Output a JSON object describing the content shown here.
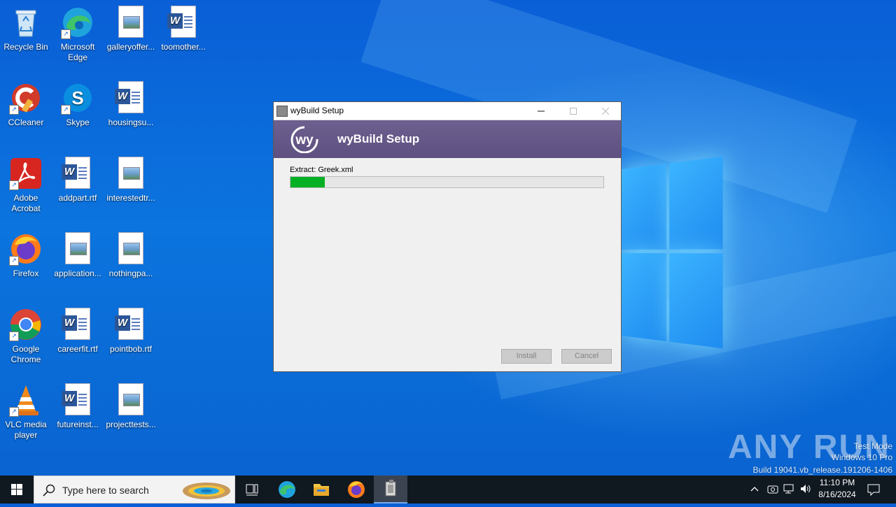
{
  "desktop": {
    "icons": [
      {
        "label": "Recycle Bin",
        "icon": "recycle-bin-icon"
      },
      {
        "label": "Microsoft Edge",
        "icon": "edge-icon"
      },
      {
        "label": "galleryoffer...",
        "icon": "image-file-icon"
      },
      {
        "label": "toomother...",
        "icon": "word-file-icon"
      },
      {
        "label": "CCleaner",
        "icon": "ccleaner-icon"
      },
      {
        "label": "Skype",
        "icon": "skype-icon"
      },
      {
        "label": "housingsu...",
        "icon": "word-file-icon"
      },
      {
        "label": "Adobe Acrobat",
        "icon": "acrobat-icon"
      },
      {
        "label": "addpart.rtf",
        "icon": "word-file-icon"
      },
      {
        "label": "interestedtr...",
        "icon": "image-file-icon"
      },
      {
        "label": "Firefox",
        "icon": "firefox-icon"
      },
      {
        "label": "application...",
        "icon": "image-file-icon"
      },
      {
        "label": "nothingpa...",
        "icon": "image-file-icon"
      },
      {
        "label": "Google Chrome",
        "icon": "chrome-icon"
      },
      {
        "label": "careerfit.rtf",
        "icon": "word-file-icon"
      },
      {
        "label": "pointbob.rtf",
        "icon": "word-file-icon"
      },
      {
        "label": "VLC media player",
        "icon": "vlc-icon"
      },
      {
        "label": "futureinst...",
        "icon": "word-file-icon"
      },
      {
        "label": "projecttests...",
        "icon": "image-file-icon"
      }
    ]
  },
  "dialog": {
    "window_title": "wyBuild Setup",
    "header_title": "wyBuild Setup",
    "status_text": "Extract: Greek.xml",
    "progress_fraction": 0.11,
    "install_label": "Install",
    "cancel_label": "Cancel",
    "header_color": "#6d5f8e",
    "progress_color": "#06b025"
  },
  "taskbar": {
    "search_placeholder": "Type here to search",
    "time": "11:10 PM",
    "date": "8/16/2024"
  },
  "watermark": {
    "line1": "Test Mode",
    "line2": "Windows 10 Pro",
    "line3": "Build 19041.vb_release.191206-1406",
    "brand": "ANY RUN"
  }
}
